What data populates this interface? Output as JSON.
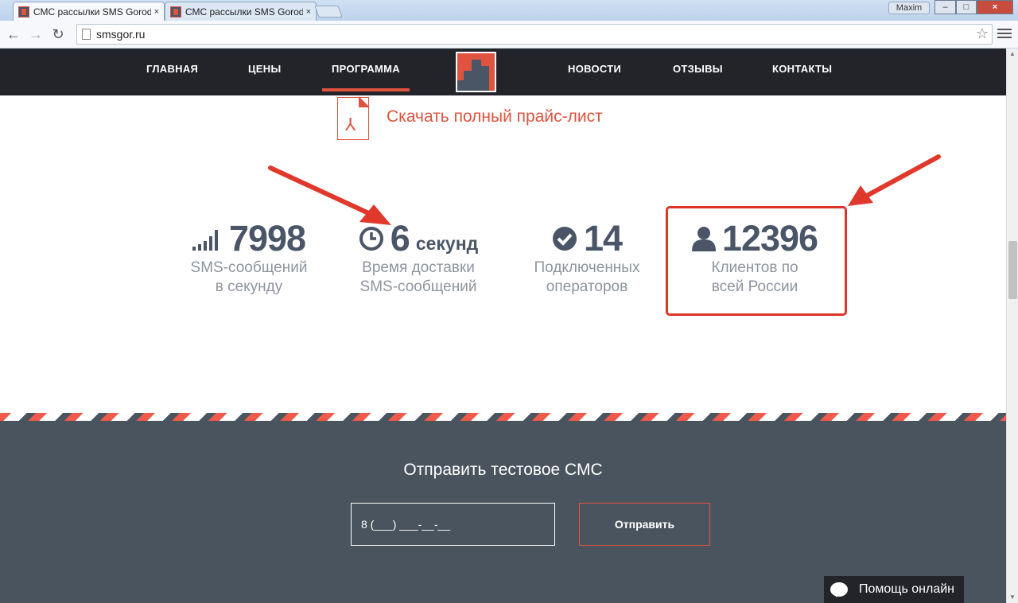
{
  "browser": {
    "tabs": [
      {
        "title": "СМС рассылки SMS Gorod",
        "active": true
      },
      {
        "title": "СМС рассылки SMS Gorod",
        "active": false
      }
    ],
    "user": "Maxim",
    "url": "smsgor.ru",
    "close_glyph": "×"
  },
  "nav": {
    "items": [
      {
        "label": "ГЛАВНАЯ"
      },
      {
        "label": "ЦЕНЫ"
      },
      {
        "label": "ПРОГРАММА",
        "active": true
      },
      {
        "label": "НОВОСТИ"
      },
      {
        "label": "ОТЗЫВЫ"
      },
      {
        "label": "КОНТАКТЫ"
      }
    ]
  },
  "download": {
    "label": "Скачать полный прайс-лист",
    "icon": "pdf-icon"
  },
  "stats": [
    {
      "icon": "signal-bars-icon",
      "number": "7998",
      "unit": "",
      "caption_1": "SMS-сообщений",
      "caption_2": "в секунду"
    },
    {
      "icon": "clock-icon",
      "number": "6",
      "unit": "секунд",
      "caption_1": "Время доставки",
      "caption_2": "SMS-сообщений"
    },
    {
      "icon": "check-circle-icon",
      "number": "14",
      "unit": "",
      "caption_1": "Подключенных",
      "caption_2": "операторов"
    },
    {
      "icon": "user-icon",
      "number": "12396",
      "unit": "",
      "caption_1": "Клиентов по",
      "caption_2": "всей России"
    }
  ],
  "test_sms": {
    "title": "Отправить тестовое СМС",
    "phone_value": "8 (___) ___-__-__",
    "send_label": "Отправить"
  },
  "help_chat": {
    "label": "Помощь онлайн"
  },
  "colors": {
    "accent": "#e0533f",
    "dark": "#22242a",
    "section": "#4a545e",
    "annotation": "#e0332a"
  }
}
